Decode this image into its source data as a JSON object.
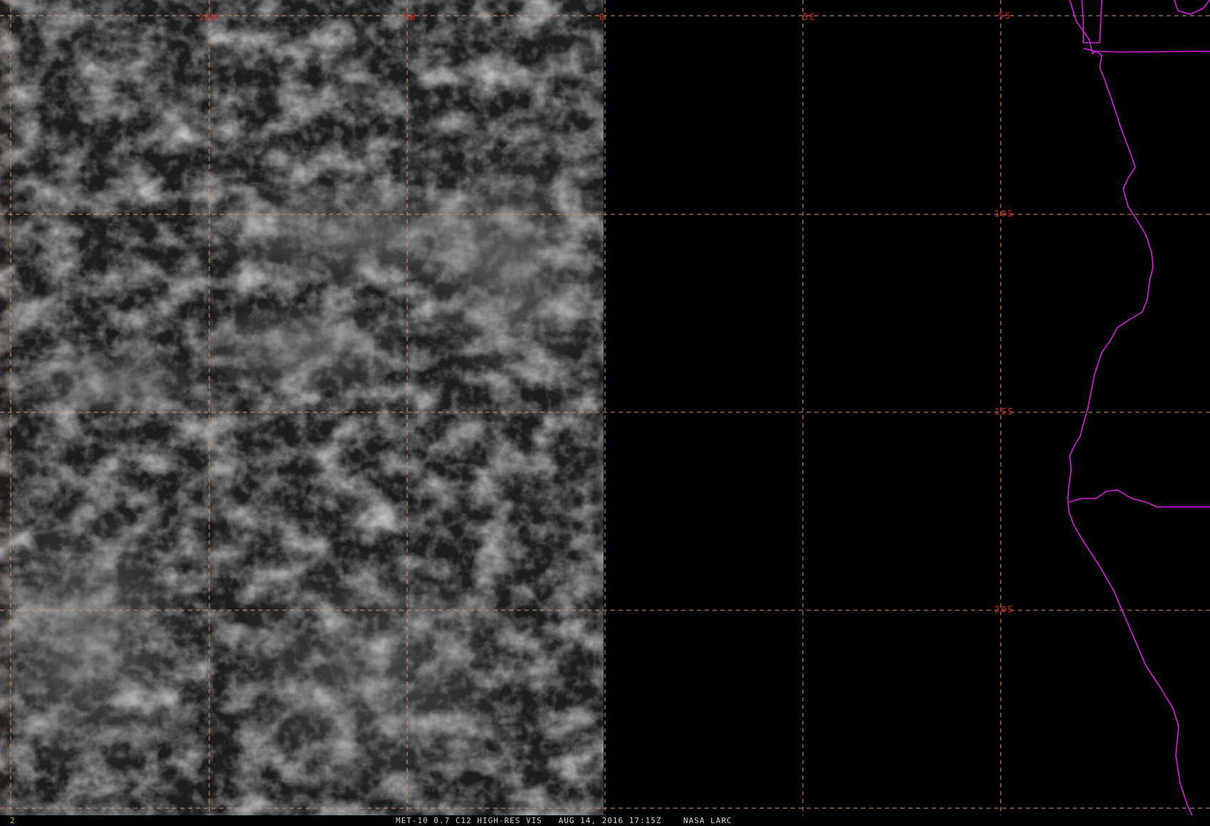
{
  "map": {
    "longitude_labels": [
      "10W",
      "5W",
      "0",
      "5E"
    ],
    "latitude_labels": [
      "5S",
      "10S",
      "15S",
      "20S"
    ],
    "colors": {
      "grid": "#d9966b",
      "grid_labels": "#e0251c",
      "coastline": "#d81ce0",
      "status_caption": "#d8d8d8",
      "frame_number": "#e0c21c"
    }
  },
  "status_bar": {
    "frame_number": "2",
    "caption": "MET-10 0.7 C12 HIGH-RES VIS   AUG 14, 2016 17:15Z    NASA LARC"
  }
}
